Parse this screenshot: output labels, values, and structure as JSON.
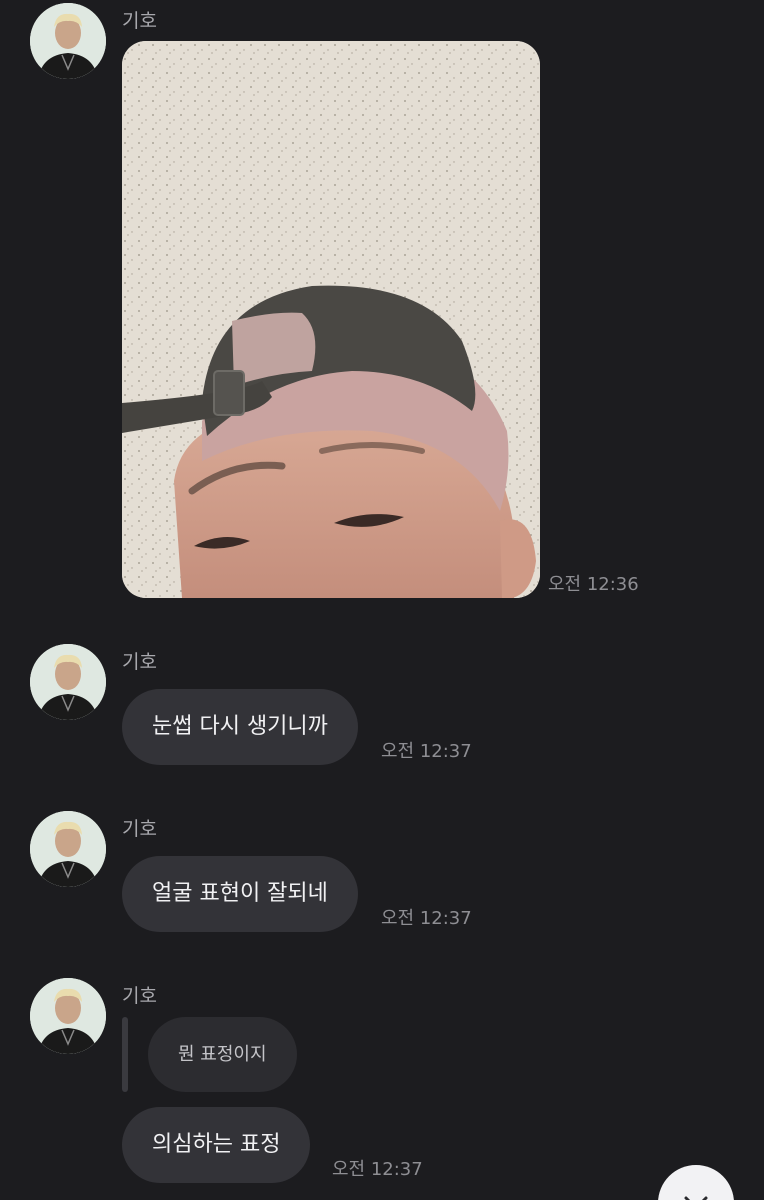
{
  "messages": [
    {
      "sender": "기호",
      "type": "photo",
      "time": "오전 12:36"
    },
    {
      "sender": "기호",
      "type": "text",
      "text": "눈썹 다시 생기니까",
      "time": "오전 12:37"
    },
    {
      "sender": "기호",
      "type": "text",
      "text": "얼굴 표현이 잘되네",
      "time": "오전 12:37"
    },
    {
      "sender": "기호",
      "type": "reply",
      "quoted": "뭔 표정이지",
      "text": "의심하는 표정",
      "time": "오전 12:37"
    }
  ],
  "colors": {
    "background": "#1c1c1f",
    "bubble": "#333338",
    "quoted_bubble": "#2c2c30",
    "text": "#f1f1f3",
    "secondary_text": "#8e8e93"
  },
  "icons": {
    "scroll_down": "chevron-down-icon"
  }
}
